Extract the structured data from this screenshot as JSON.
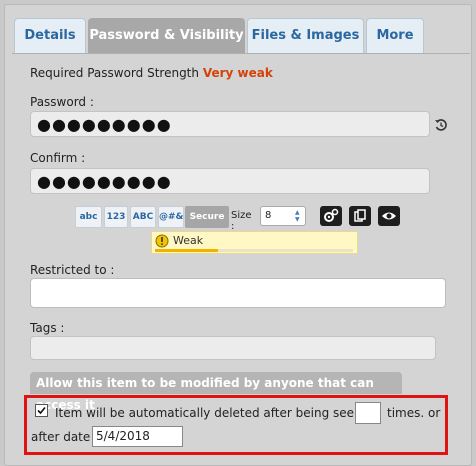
{
  "tabs": [
    {
      "label": "Details",
      "active": false
    },
    {
      "label": "Password & Visibility",
      "active": true
    },
    {
      "label": "Files & Images",
      "active": false
    },
    {
      "label": "More",
      "active": false
    }
  ],
  "password_strength": {
    "label": "Required Password Strength",
    "value": "Very weak"
  },
  "password": {
    "label": "Password :",
    "value": "●●●●●●●●●"
  },
  "confirm": {
    "label": "Confirm :",
    "value": "●●●●●●●●●"
  },
  "generator": {
    "chips": [
      "abc",
      "123",
      "ABC",
      "@#&",
      "Secure"
    ],
    "size_label": "Size :",
    "size_value": "8"
  },
  "strength_meter": {
    "label": "Weak",
    "level": 0.32,
    "color": "#f0b400"
  },
  "restricted_to": {
    "label": "Restricted to :",
    "value": ""
  },
  "tags": {
    "label": "Tags :",
    "value": ""
  },
  "modify_section": {
    "title": "Allow this item to be modified by anyone that can access it"
  },
  "auto_delete": {
    "checked": true,
    "text_before": "Item will be automatically deleted after being seen",
    "times_value": "",
    "text_after": "times.   or",
    "date_label": "after date",
    "date_value": "5/4/2018"
  },
  "colors": {
    "highlight": "#e01212",
    "weak_text": "#d4420b",
    "tab_text": "#2b67a0"
  }
}
